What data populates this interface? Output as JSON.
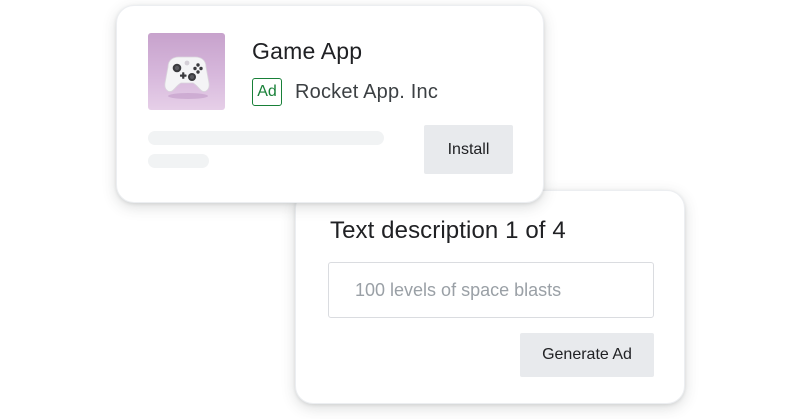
{
  "app_card": {
    "app_name": "Game App",
    "ad_badge": "Ad",
    "advertiser": "Rocket App. Inc",
    "install_label": "Install",
    "icon": "game-controller-icon",
    "icon_bg_color": "#d7b8dc"
  },
  "description_card": {
    "title": "Text description 1 of 4",
    "input_value": "",
    "input_placeholder": "100 levels of space blasts",
    "generate_label": "Generate Ad"
  },
  "colors": {
    "ad_badge": "#188038",
    "button_bg": "#e8eaed",
    "skeleton": "#f1f3f4"
  }
}
